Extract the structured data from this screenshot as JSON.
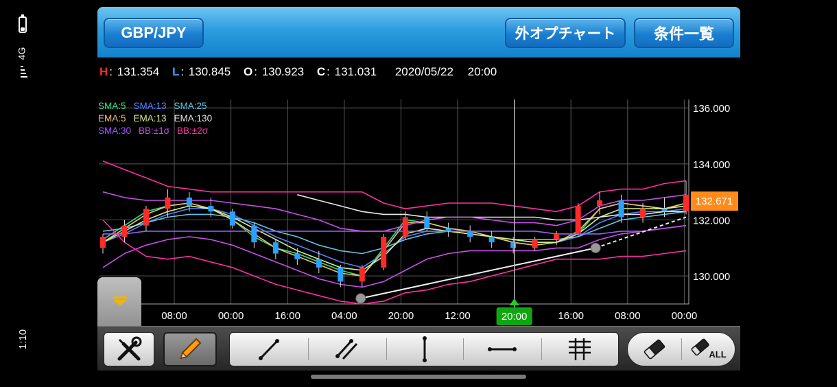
{
  "status": {
    "time": "1:10",
    "network": "4G"
  },
  "header": {
    "symbol": "GBP/JPY",
    "external_chart_label": "外オプチャート",
    "conditions_label": "条件一覧"
  },
  "ohlc": {
    "h_key": "H",
    "h_value": "131.354",
    "l_key": "L",
    "l_value": "130.845",
    "o_key": "O",
    "o_value": "130.923",
    "c_key": "C",
    "c_value": "131.031",
    "date": "2020/05/22",
    "time": "20:00"
  },
  "legend": {
    "rows": [
      [
        {
          "label": "SMA:5",
          "color": "#2ee08a"
        },
        {
          "label": "SMA:13",
          "color": "#5a7fff"
        },
        {
          "label": "SMA:25",
          "color": "#5cc8e8"
        }
      ],
      [
        {
          "label": "EMA:5",
          "color": "#f0c36a"
        },
        {
          "label": "EMA:13",
          "color": "#d8f08a"
        },
        {
          "label": "EMA:130",
          "color": "#e8e8e8"
        }
      ],
      [
        {
          "label": "SMA:30",
          "color": "#9a5cff"
        },
        {
          "label": "BB:±1σ",
          "color": "#c850e8"
        },
        {
          "label": "BB:±2σ",
          "color": "#ff2ea8"
        }
      ]
    ]
  },
  "chart_data": {
    "type": "line",
    "title": "",
    "xlabel": "",
    "ylabel": "",
    "x_ticks": [
      "08:00",
      "00:00",
      "16:00",
      "04:00",
      "20:00",
      "12:00",
      "20:00",
      "16:00",
      "08:00",
      "00:00"
    ],
    "y_ticks": [
      "136.000",
      "134.000",
      "132.000",
      "130.000"
    ],
    "ylim": [
      129.0,
      136.3
    ],
    "current_price": "132.671",
    "crosshair_label": "20:00",
    "grid": true,
    "series": [
      {
        "name": "SMA:5",
        "color": "#2ee08a",
        "values": [
          131.3,
          131.8,
          132.3,
          132.5,
          132.6,
          132.4,
          132.0,
          131.4,
          131.0,
          130.8,
          130.5,
          130.2,
          130.0,
          131.0,
          132.0,
          131.9,
          131.7,
          131.6,
          131.4,
          131.2,
          131.1,
          131.2,
          131.5,
          132.4,
          132.6,
          132.5,
          132.4,
          132.6
        ]
      },
      {
        "name": "SMA:13",
        "color": "#5a7fff",
        "values": [
          131.2,
          131.5,
          131.9,
          132.2,
          132.4,
          132.4,
          132.2,
          131.8,
          131.4,
          131.1,
          130.8,
          130.5,
          130.3,
          130.8,
          131.4,
          131.6,
          131.6,
          131.5,
          131.4,
          131.3,
          131.2,
          131.2,
          131.4,
          131.9,
          132.2,
          132.3,
          132.3,
          132.4
        ]
      },
      {
        "name": "SMA:25",
        "color": "#5cc8e8",
        "values": [
          131.6,
          131.7,
          131.9,
          132.1,
          132.2,
          132.2,
          132.1,
          131.9,
          131.6,
          131.4,
          131.1,
          130.9,
          130.8,
          131.0,
          131.3,
          131.5,
          131.6,
          131.5,
          131.4,
          131.3,
          131.3,
          131.3,
          131.4,
          131.7,
          132.0,
          132.1,
          132.2,
          132.3
        ]
      },
      {
        "name": "EMA:5",
        "color": "#f0c36a",
        "values": [
          131.2,
          131.7,
          132.2,
          132.5,
          132.6,
          132.4,
          132.0,
          131.5,
          131.0,
          130.7,
          130.4,
          130.1,
          130.0,
          130.9,
          131.9,
          131.9,
          131.7,
          131.6,
          131.4,
          131.2,
          131.1,
          131.2,
          131.6,
          132.4,
          132.6,
          132.5,
          132.4,
          132.6
        ]
      },
      {
        "name": "EMA:13",
        "color": "#d8f08a",
        "values": [
          131.2,
          131.6,
          132.0,
          132.3,
          132.5,
          132.4,
          132.1,
          131.7,
          131.3,
          130.9,
          130.6,
          130.3,
          130.2,
          130.7,
          131.5,
          131.7,
          131.6,
          131.5,
          131.4,
          131.3,
          131.2,
          131.2,
          131.5,
          132.1,
          132.4,
          132.4,
          132.4,
          132.5
        ]
      },
      {
        "name": "EMA:130",
        "color": "#e8e8e8",
        "values": [
          null,
          null,
          null,
          null,
          null,
          null,
          null,
          null,
          null,
          132.9,
          132.7,
          132.5,
          132.3,
          132.2,
          132.2,
          132.1,
          132.1,
          132.1,
          132.1,
          132.1,
          132.1,
          132.0,
          132.0,
          132.1,
          132.2,
          132.2,
          132.3,
          132.3
        ]
      },
      {
        "name": "SMA:30",
        "color": "#9a5cff",
        "values": [
          131.5,
          131.5,
          131.6,
          131.6,
          131.6,
          131.6,
          131.6,
          131.6,
          131.6,
          131.6,
          131.6,
          131.6,
          131.6,
          131.6,
          131.6,
          131.6,
          131.6,
          131.6,
          131.6,
          131.6,
          131.6,
          131.5,
          131.5,
          131.5,
          131.6,
          131.6,
          131.7,
          131.8
        ]
      },
      {
        "name": "BB:+2σ",
        "color": "#ff2ea8",
        "values": [
          134.1,
          133.8,
          133.5,
          133.2,
          133.1,
          133.0,
          133.0,
          133.0,
          133.0,
          133.0,
          133.0,
          133.0,
          133.0,
          132.6,
          132.4,
          132.5,
          132.6,
          132.6,
          132.6,
          132.5,
          132.4,
          132.3,
          132.5,
          133.0,
          133.1,
          133.1,
          133.3,
          133.4
        ]
      },
      {
        "name": "BB:-2σ",
        "color": "#ff2ea8",
        "values": [
          132.0,
          131.2,
          130.7,
          130.6,
          130.7,
          130.5,
          130.3,
          130.0,
          129.7,
          129.5,
          129.3,
          129.1,
          129.0,
          129.1,
          129.4,
          129.5,
          129.7,
          129.8,
          130.0,
          130.2,
          130.4,
          130.6,
          130.6,
          130.6,
          130.7,
          130.7,
          130.8,
          130.9
        ]
      },
      {
        "name": "BB:+1σ",
        "color": "#c850e8",
        "values": [
          133.0,
          132.8,
          132.7,
          132.7,
          132.7,
          132.7,
          132.6,
          132.5,
          132.4,
          132.2,
          132.0,
          131.7,
          131.6,
          131.6,
          131.8,
          132.0,
          132.1,
          132.1,
          132.0,
          131.9,
          131.9,
          131.8,
          132.0,
          132.5,
          132.7,
          132.7,
          132.8,
          132.9
        ]
      },
      {
        "name": "BB:-1σ",
        "color": "#c850e8",
        "values": [
          130.3,
          130.8,
          131.1,
          131.3,
          131.4,
          131.3,
          131.1,
          130.8,
          130.5,
          130.2,
          129.9,
          129.7,
          129.6,
          129.8,
          130.2,
          130.6,
          130.8,
          130.9,
          130.9,
          130.9,
          130.9,
          131.0,
          131.0,
          131.3,
          131.5,
          131.6,
          131.7,
          131.8
        ]
      }
    ],
    "candles": [
      [
        131.0,
        131.5,
        130.8,
        131.4
      ],
      [
        131.4,
        132.0,
        131.2,
        131.8
      ],
      [
        131.8,
        132.5,
        131.6,
        132.4
      ],
      [
        132.4,
        133.1,
        132.1,
        132.8
      ],
      [
        132.8,
        133.0,
        132.3,
        132.5
      ],
      [
        132.5,
        132.8,
        132.1,
        132.3
      ],
      [
        132.3,
        132.4,
        131.7,
        131.8
      ],
      [
        131.8,
        131.9,
        131.0,
        131.2
      ],
      [
        131.2,
        131.3,
        130.6,
        130.8
      ],
      [
        130.8,
        131.0,
        130.4,
        130.6
      ],
      [
        130.6,
        130.9,
        130.1,
        130.3
      ],
      [
        130.3,
        130.4,
        129.6,
        129.8
      ],
      [
        129.8,
        130.4,
        129.6,
        130.3
      ],
      [
        130.3,
        131.5,
        130.2,
        131.4
      ],
      [
        131.4,
        132.3,
        131.3,
        132.1
      ],
      [
        132.1,
        132.3,
        131.6,
        131.7
      ],
      [
        131.7,
        131.9,
        131.4,
        131.6
      ],
      [
        131.6,
        131.8,
        131.2,
        131.4
      ],
      [
        131.4,
        131.6,
        131.0,
        131.2
      ],
      [
        131.2,
        131.4,
        130.8,
        131.0
      ],
      [
        131.0,
        131.4,
        130.9,
        131.3
      ],
      [
        131.3,
        131.6,
        131.1,
        131.5
      ],
      [
        131.5,
        132.6,
        131.4,
        132.5
      ],
      [
        132.5,
        133.0,
        132.2,
        132.7
      ],
      [
        132.7,
        132.9,
        131.9,
        132.1
      ],
      [
        132.1,
        132.6,
        131.9,
        132.4
      ],
      [
        132.4,
        132.8,
        132.1,
        132.3
      ],
      [
        132.3,
        133.4,
        132.2,
        132.9
      ]
    ]
  },
  "toolbar": {
    "tools_icon": "wrench-screwdriver-icon",
    "pencil_icon": "pencil-icon",
    "trend_line_icon": "trendline-icon",
    "channel_icon": "parallel-lines-icon",
    "vline_icon": "vertical-line-icon",
    "hline_icon": "horizontal-line-icon",
    "fib_icon": "fibonacci-icon",
    "eraser_icon": "eraser-icon",
    "erase_all_label": "ALL"
  }
}
